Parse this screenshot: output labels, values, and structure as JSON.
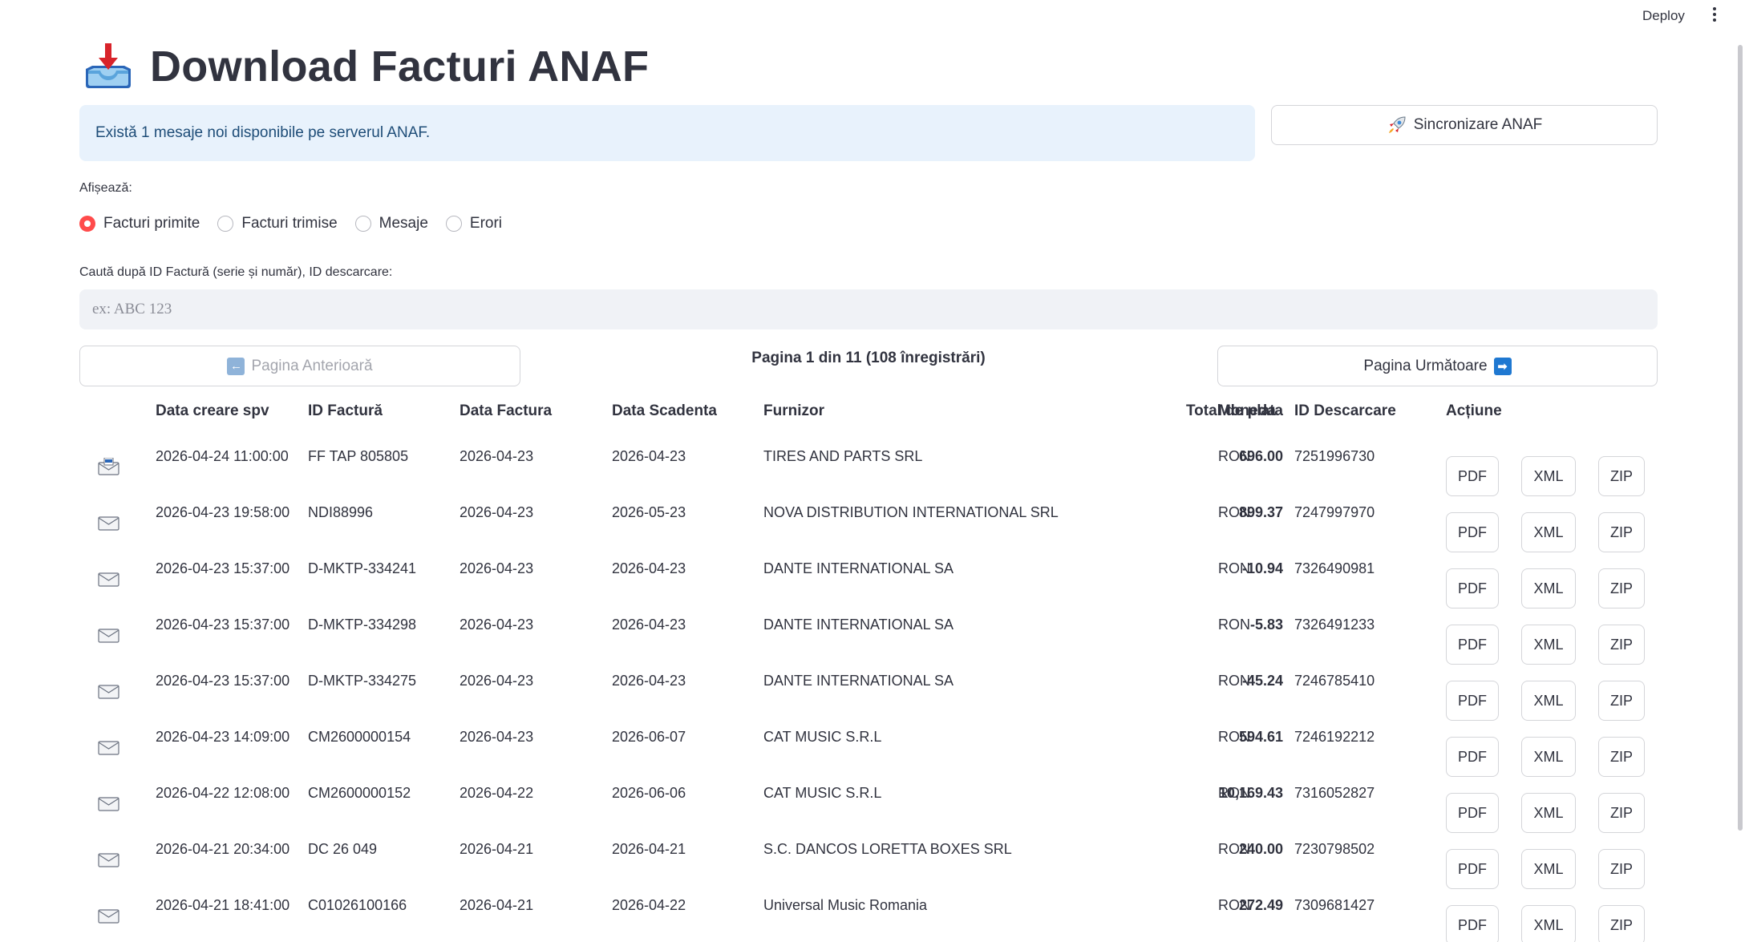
{
  "topbar": {
    "deploy_label": "Deploy"
  },
  "page": {
    "title": "Download Facturi ANAF"
  },
  "info": {
    "message": "Există 1 mesaje noi disponibile pe serverul ANAF."
  },
  "sync": {
    "label": "Sincronizare ANAF"
  },
  "filter": {
    "label": "Afișează:",
    "options": [
      "Facturi primite",
      "Facturi trimise",
      "Mesaje",
      "Erori"
    ],
    "selected": "Facturi primite"
  },
  "search": {
    "label": "Caută după ID Factură (serie și număr), ID descarcare:",
    "placeholder": "ex: ABC 123",
    "value": ""
  },
  "pagination": {
    "prev_label": "Pagina Anterioară",
    "next_label": "Pagina Următoare",
    "info": "Pagina 1 din 11 (108 înregistrări)"
  },
  "table": {
    "columns": [
      "Data creare spv",
      "ID Factură",
      "Data Factura",
      "Data Scadenta",
      "Furnizor",
      "Total de plata",
      "Moneda",
      "ID Descarcare",
      "Acțiune"
    ],
    "action_labels": {
      "pdf": "PDF",
      "xml": "XML",
      "zip": "ZIP"
    },
    "rows": [
      {
        "created": "2026-04-24 11:00:00",
        "invoice_id": "FF TAP 805805",
        "invoice_date": "2026-04-23",
        "due_date": "2026-04-23",
        "supplier": "TIRES AND PARTS SRL",
        "total": "696.00",
        "currency": "RON",
        "download_id": "7251996730",
        "icon": "envelope-new-icon"
      },
      {
        "created": "2026-04-23 19:58:00",
        "invoice_id": "NDI88996",
        "invoice_date": "2026-04-23",
        "due_date": "2026-05-23",
        "supplier": "NOVA DISTRIBUTION INTERNATIONAL SRL",
        "total": "899.37",
        "currency": "RON",
        "download_id": "7247997970",
        "icon": "envelope-icon"
      },
      {
        "created": "2026-04-23 15:37:00",
        "invoice_id": "D-MKTP-334241",
        "invoice_date": "2026-04-23",
        "due_date": "2026-04-23",
        "supplier": "DANTE INTERNATIONAL SA",
        "total": "-10.94",
        "currency": "RON",
        "download_id": "7326490981",
        "icon": "envelope-icon"
      },
      {
        "created": "2026-04-23 15:37:00",
        "invoice_id": "D-MKTP-334298",
        "invoice_date": "2026-04-23",
        "due_date": "2026-04-23",
        "supplier": "DANTE INTERNATIONAL SA",
        "total": "-5.83",
        "currency": "RON",
        "download_id": "7326491233",
        "icon": "envelope-icon"
      },
      {
        "created": "2026-04-23 15:37:00",
        "invoice_id": "D-MKTP-334275",
        "invoice_date": "2026-04-23",
        "due_date": "2026-04-23",
        "supplier": "DANTE INTERNATIONAL SA",
        "total": "-45.24",
        "currency": "RON",
        "download_id": "7246785410",
        "icon": "envelope-icon"
      },
      {
        "created": "2026-04-23 14:09:00",
        "invoice_id": "CM2600000154",
        "invoice_date": "2026-04-23",
        "due_date": "2026-06-07",
        "supplier": "CAT MUSIC S.R.L",
        "total": "594.61",
        "currency": "RON",
        "download_id": "7246192212",
        "icon": "envelope-icon"
      },
      {
        "created": "2026-04-22 12:08:00",
        "invoice_id": "CM2600000152",
        "invoice_date": "2026-04-22",
        "due_date": "2026-06-06",
        "supplier": "CAT MUSIC S.R.L",
        "total": "10,169.43",
        "currency": "RON",
        "download_id": "7316052827",
        "icon": "envelope-icon"
      },
      {
        "created": "2026-04-21 20:34:00",
        "invoice_id": "DC 26 049",
        "invoice_date": "2026-04-21",
        "due_date": "2026-04-21",
        "supplier": "S.C. DANCOS LORETTA BOXES SRL",
        "total": "240.00",
        "currency": "RON",
        "download_id": "7230798502",
        "icon": "envelope-icon"
      },
      {
        "created": "2026-04-21 18:41:00",
        "invoice_id": "C01026100166",
        "invoice_date": "2026-04-21",
        "due_date": "2026-04-22",
        "supplier": "Universal Music Romania",
        "total": "272.49",
        "currency": "RON",
        "download_id": "7309681427",
        "icon": "envelope-icon"
      }
    ]
  },
  "colors": {
    "accent": "#ff4b4b",
    "info_bg": "#e8f2fc",
    "info_text": "#1e4d78",
    "input_bg": "#f0f2f6",
    "next_arrow": "#1f78d1"
  }
}
